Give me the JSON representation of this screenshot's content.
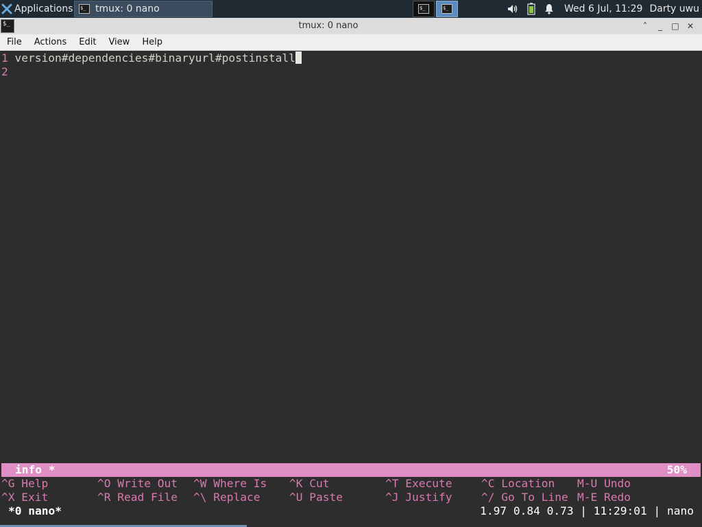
{
  "panel": {
    "apps_label": "Applications ☰",
    "task_label": "tmux: 0 nano",
    "clock": "Wed  6 Jul, 11:29",
    "user": "Darty uwu",
    "term_glyph": "$_"
  },
  "window": {
    "title": "tmux: 0 nano",
    "minimize": "˄",
    "iconify": "_",
    "maximize": "□",
    "close": "✕"
  },
  "menu": [
    "File",
    "Actions",
    "Edit",
    "View",
    "Help"
  ],
  "editor": {
    "lines": [
      {
        "num": "1",
        "text": "version#dependencies#binaryurl#postinstall"
      },
      {
        "num": "2",
        "text": ""
      }
    ]
  },
  "tmux_bar": {
    "left": "info *",
    "right": "50%"
  },
  "shortcuts": [
    {
      "key": "^G",
      "label": "Help"
    },
    {
      "key": "^O",
      "label": "Write Out"
    },
    {
      "key": "^W",
      "label": "Where Is"
    },
    {
      "key": "^K",
      "label": "Cut"
    },
    {
      "key": "^T",
      "label": "Execute"
    },
    {
      "key": "^C",
      "label": "Location"
    },
    {
      "key": "M-U",
      "label": "Undo"
    },
    {
      "key": "^X",
      "label": "Exit"
    },
    {
      "key": "^R",
      "label": "Read File"
    },
    {
      "key": "^\\",
      "label": "Replace"
    },
    {
      "key": "^U",
      "label": "Paste"
    },
    {
      "key": "^J",
      "label": "Justify"
    },
    {
      "key": "^/",
      "label": "Go To Line"
    },
    {
      "key": "M-E",
      "label": "Redo"
    }
  ],
  "status": {
    "left": "*0 nano*",
    "right": "1.97 0.84 0.73 | 11:29:01 | nano"
  },
  "colors": {
    "accent": "#d879b0",
    "tmux_bar": "#e08fc4",
    "panel": "#1f2a33",
    "terminal_bg": "#2d2d2d"
  }
}
